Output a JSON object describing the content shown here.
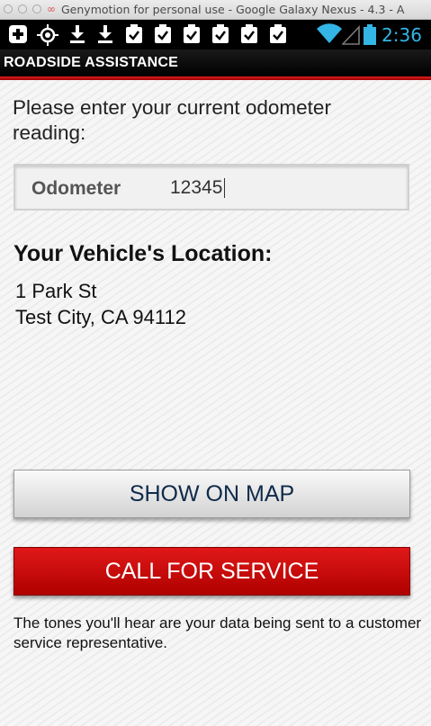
{
  "window": {
    "title": "Genymotion for personal use - Google Galaxy Nexus - 4.3 - A"
  },
  "status_bar": {
    "time": "2:36",
    "icons": [
      "plus-box-icon",
      "gps-icon",
      "download-icon",
      "download-icon",
      "clipboard-check-icon",
      "clipboard-check-icon",
      "clipboard-check-icon",
      "clipboard-check-icon",
      "clipboard-check-icon",
      "clipboard-check-icon",
      "wifi-icon",
      "signal-icon",
      "battery-icon"
    ],
    "accent_color": "#33b5e5"
  },
  "action_bar": {
    "title": "ROADSIDE ASSISTANCE",
    "accent_color": "#cc0000"
  },
  "form": {
    "prompt": "Please enter your current odometer reading:",
    "odometer_label": "Odometer",
    "odometer_value": "12345"
  },
  "location": {
    "heading": "Your Vehicle's Location:",
    "line1": "1 Park St",
    "line2": "Test City, CA 94112"
  },
  "buttons": {
    "show_map": "SHOW ON MAP",
    "call_service": "CALL FOR SERVICE"
  },
  "footnote": "The tones you'll hear are your data being sent to a customer service representative."
}
